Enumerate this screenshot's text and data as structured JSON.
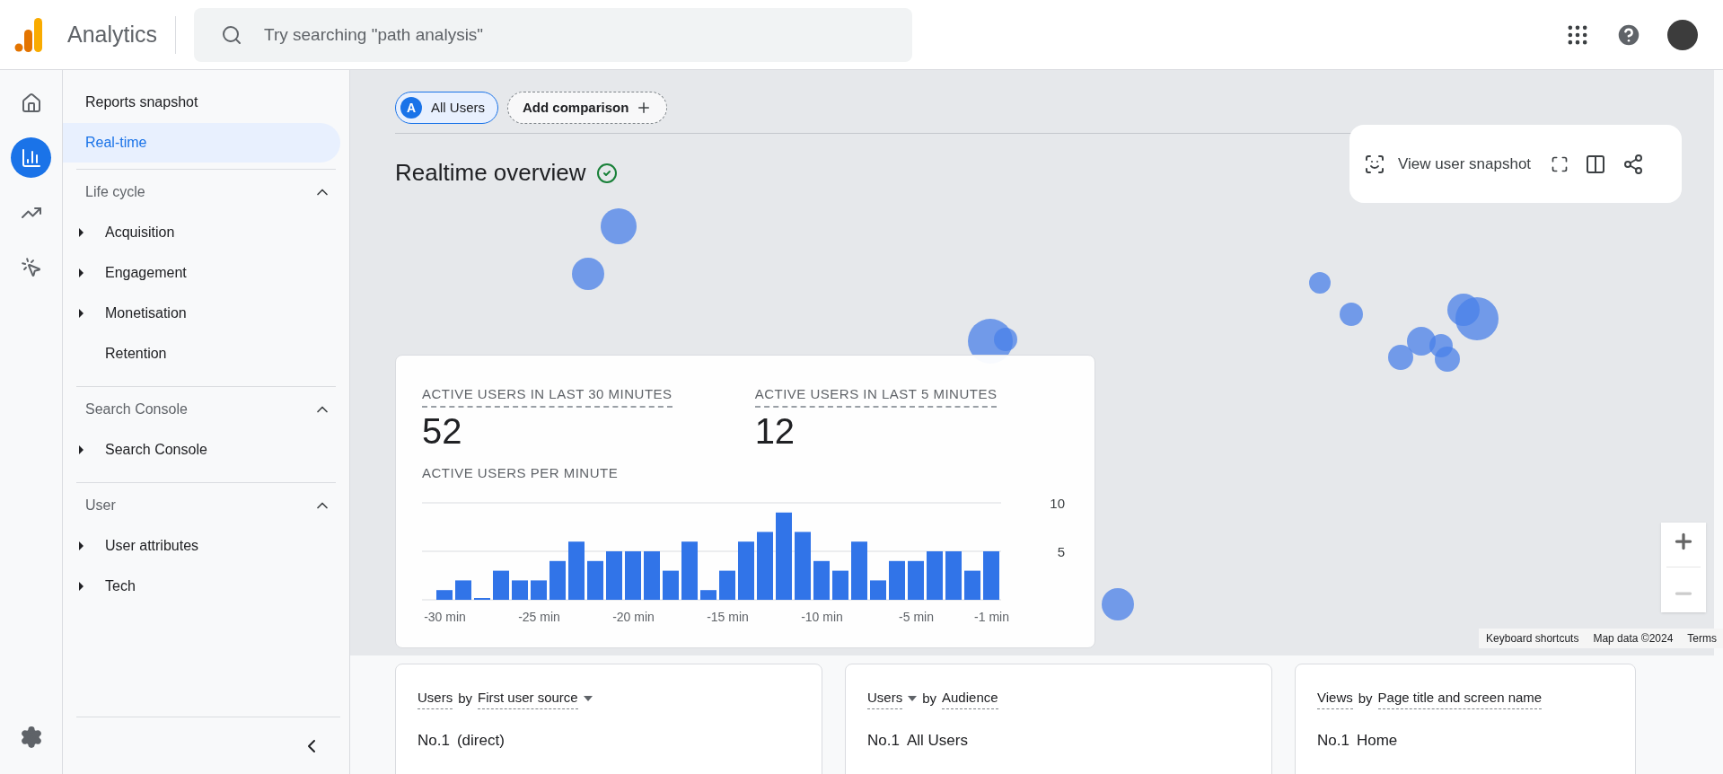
{
  "app": {
    "title": "Analytics"
  },
  "search": {
    "placeholder": "Try searching \"path analysis\""
  },
  "rail": [
    {
      "kind": "home",
      "selected": false
    },
    {
      "kind": "reports",
      "selected": true
    },
    {
      "kind": "explore",
      "selected": false
    },
    {
      "kind": "advertising",
      "selected": false
    }
  ],
  "nav": {
    "items": [
      {
        "label": "Reports snapshot",
        "selected": false
      },
      {
        "label": "Real-time",
        "selected": true
      }
    ],
    "sections": [
      {
        "title": "Life cycle",
        "expanded": true,
        "items": [
          {
            "label": "Acquisition",
            "expandable": true
          },
          {
            "label": "Engagement",
            "expandable": true
          },
          {
            "label": "Monetisation",
            "expandable": true
          },
          {
            "label": "Retention",
            "expandable": false
          }
        ]
      },
      {
        "title": "Search Console",
        "expanded": true,
        "items": [
          {
            "label": "Search Console",
            "expandable": true
          }
        ]
      },
      {
        "title": "User",
        "expanded": true,
        "items": [
          {
            "label": "User attributes",
            "expandable": true
          },
          {
            "label": "Tech",
            "expandable": true
          }
        ]
      }
    ]
  },
  "comparison": {
    "badge": "A",
    "segment": "All Users",
    "add_label": "Add comparison"
  },
  "page_title": "Realtime overview",
  "toolbar": {
    "snapshot_label": "View user snapshot"
  },
  "stats": [
    {
      "label": "ACTIVE USERS IN LAST 30 MINUTES",
      "value": "52"
    },
    {
      "label": "ACTIVE USERS IN LAST 5 MINUTES",
      "value": "12"
    }
  ],
  "chart": {
    "title": "ACTIVE USERS PER MINUTE",
    "chart_data": {
      "type": "bar",
      "x": [
        -30,
        -29,
        -28,
        -27,
        -26,
        -25,
        -24,
        -23,
        -22,
        -21,
        -20,
        -19,
        -18,
        -17,
        -16,
        -15,
        -14,
        -13,
        -12,
        -11,
        -10,
        -9,
        -8,
        -7,
        -6,
        -5,
        -4,
        -3,
        -2,
        -1
      ],
      "series": [
        {
          "color": "#3174e8",
          "values": [
            1,
            2,
            0,
            3,
            2,
            2,
            4,
            6,
            4,
            5,
            5,
            5,
            3,
            6,
            1,
            3,
            6,
            7,
            9,
            7,
            4,
            3,
            6,
            2,
            4,
            4,
            5,
            5,
            3,
            5
          ]
        }
      ],
      "xlim": [
        -30.5,
        -0.5
      ],
      "ylim": [
        0,
        10
      ],
      "yticks": [
        5,
        10
      ],
      "xticks": [
        {
          "value": -30,
          "label": "-30 min"
        },
        {
          "value": -25,
          "label": "-25 min"
        },
        {
          "value": -20,
          "label": "-20 min"
        },
        {
          "value": -15,
          "label": "-15 min"
        },
        {
          "value": -10,
          "label": "-10 min"
        },
        {
          "value": -5,
          "label": "-5 min"
        },
        {
          "value": -1,
          "label": "-1 min"
        }
      ]
    }
  },
  "map": {
    "attribution": [
      "Keyboard shortcuts",
      "Map data ©2024",
      "Terms"
    ]
  },
  "cards": [
    {
      "metric": "Users",
      "metric_dropdown": false,
      "joiner": "by",
      "dimension": "First user source",
      "dimension_dropdown": true,
      "rank": "No.1",
      "top": "(direct)"
    },
    {
      "metric": "Users",
      "metric_dropdown": true,
      "joiner": "by",
      "dimension": "Audience",
      "dimension_dropdown": false,
      "rank": "No.1",
      "top": "All Users"
    },
    {
      "metric": "Views",
      "metric_dropdown": false,
      "joiner": "by",
      "dimension": "Page title and screen name",
      "dimension_dropdown": false,
      "rank": "No.1",
      "top": "Home"
    }
  ]
}
